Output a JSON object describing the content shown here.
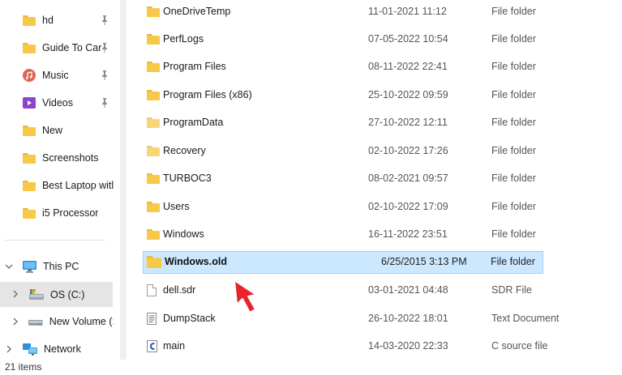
{
  "nav": {
    "quick_access": [
      {
        "label": "hd",
        "icon": "folder-icon",
        "pinned": true
      },
      {
        "label": "Guide To Car",
        "icon": "folder-icon",
        "pinned": true
      },
      {
        "label": "Music",
        "icon": "music-icon",
        "pinned": true
      },
      {
        "label": "Videos",
        "icon": "videos-icon",
        "pinned": true
      },
      {
        "label": "New",
        "icon": "folder-icon",
        "pinned": false
      },
      {
        "label": "Screenshots",
        "icon": "folder-icon",
        "pinned": false
      },
      {
        "label": "Best Laptop witl",
        "icon": "folder-icon",
        "pinned": false
      },
      {
        "label": "i5 Processor",
        "icon": "folder-icon",
        "pinned": false
      }
    ],
    "this_pc": "This PC",
    "os_drive": "OS (C:)",
    "new_volume": "New Volume (:",
    "network": "Network"
  },
  "files": [
    {
      "name": "OneDriveTemp",
      "date": "11-01-2021 11:12",
      "type": "File folder",
      "icon": "folder-icon"
    },
    {
      "name": "PerfLogs",
      "date": "07-05-2022 10:54",
      "type": "File folder",
      "icon": "folder-icon"
    },
    {
      "name": "Program Files",
      "date": "08-11-2022 22:41",
      "type": "File folder",
      "icon": "folder-icon"
    },
    {
      "name": "Program Files (x86)",
      "date": "25-10-2022 09:59",
      "type": "File folder",
      "icon": "folder-icon"
    },
    {
      "name": "ProgramData",
      "date": "27-10-2022 12:11",
      "type": "File folder",
      "icon": "folder-icon"
    },
    {
      "name": "Recovery",
      "date": "02-10-2022 17:26",
      "type": "File folder",
      "icon": "folder-icon"
    },
    {
      "name": "TURBOC3",
      "date": "08-02-2021 09:57",
      "type": "File folder",
      "icon": "folder-icon"
    },
    {
      "name": "Users",
      "date": "02-10-2022 17:09",
      "type": "File folder",
      "icon": "folder-icon"
    },
    {
      "name": "Windows",
      "date": "16-11-2022 23:51",
      "type": "File folder",
      "icon": "folder-icon"
    },
    {
      "name": "Windows.old",
      "date": "6/25/2015 3:13 PM",
      "type": "File folder",
      "icon": "folder-icon",
      "selected": true
    },
    {
      "name": "dell.sdr",
      "date": "03-01-2021 04:48",
      "type": "SDR File",
      "icon": "file-icon"
    },
    {
      "name": "DumpStack",
      "date": "26-10-2022 18:01",
      "type": "Text Document",
      "icon": "text-file-icon"
    },
    {
      "name": "main",
      "date": "14-03-2020 22:33",
      "type": "C source file",
      "icon": "c-file-icon"
    }
  ],
  "status": {
    "item_count": "21 items"
  },
  "colors": {
    "selection_bg": "#cce8ff",
    "selection_border": "#99d1ff",
    "folder": "#f7c948",
    "pointer": "#e8242a"
  }
}
